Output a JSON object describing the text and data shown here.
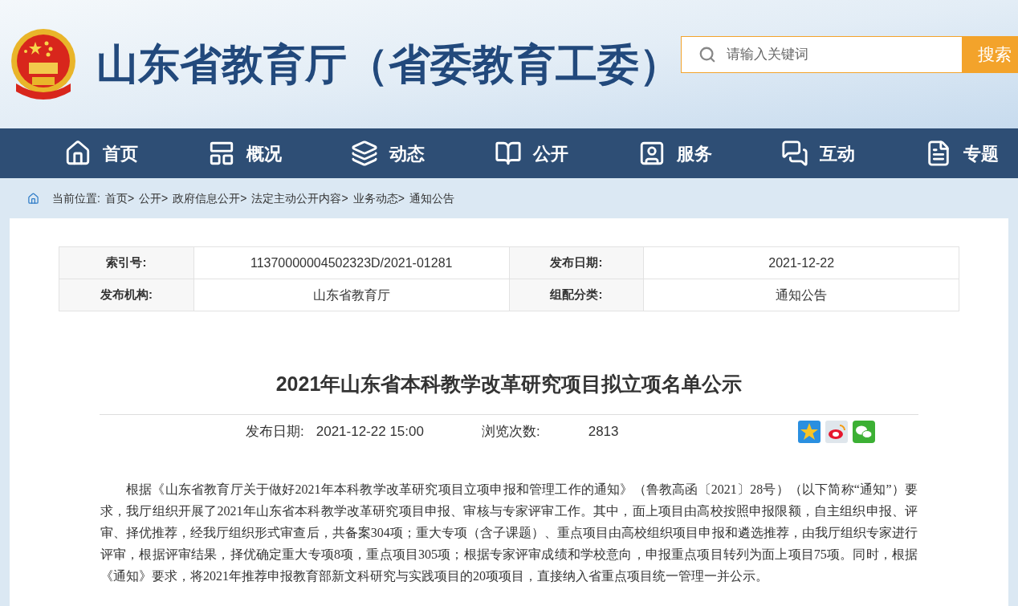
{
  "header": {
    "site_title": "山东省教育厅（省委教育工委）",
    "search": {
      "placeholder": "请输入关键词",
      "button": "搜索"
    }
  },
  "nav": [
    {
      "label": "首页",
      "kind": "home"
    },
    {
      "label": "概况",
      "kind": "overview"
    },
    {
      "label": "动态",
      "kind": "news"
    },
    {
      "label": "公开",
      "kind": "open"
    },
    {
      "label": "服务",
      "kind": "service"
    },
    {
      "label": "互动",
      "kind": "interact"
    },
    {
      "label": "专题",
      "kind": "topic"
    }
  ],
  "breadcrumb": {
    "label": "当前位置:",
    "items": [
      "首页>",
      "公开>",
      "政府信息公开>",
      "法定主动公开内容>",
      "业务动态>",
      "通知公告"
    ]
  },
  "info_table": [
    [
      {
        "label": "索引号:",
        "value": "11370000004502323D/2021-01281"
      },
      {
        "label": "发布日期:",
        "value": "2021-12-22"
      }
    ],
    [
      {
        "label": "发布机构:",
        "value": "山东省教育厅"
      },
      {
        "label": "组配分类:",
        "value": "通知公告"
      }
    ]
  ],
  "article": {
    "title": "2021年山东省本科教学改革研究项目拟立项名单公示",
    "date_label": "发布日期:",
    "date": "2021-12-22 15:00",
    "views_label": "浏览次数:",
    "views": "2813",
    "body": "根据《山东省教育厅关于做好2021年本科教学改革研究项目立项申报和管理工作的通知》（鲁教高函〔2021〕28号）（以下简称“通知”）要求，我厅组织开展了2021年山东省本科教学改革研究项目申报、审核与专家评审工作。其中，面上项目由高校按照申报限额，自主组织申报、评审、择优推荐，经我厅组织形式审查后，共备案304项；重大专项（含子课题）、重点项目由高校组织项目申报和遴选推荐，由我厅组织专家进行评审，根据评审结果，择优确定重大专项8项，重点项目305项；根据专家评审成绩和学校意向，申报重点项目转列为面上项目75项。同时，根据《通知》要求，将2021年推荐申报教育部新文科研究与实践项目的20项项目，直接纳入省重点项目统一管理一并公示。"
  }
}
